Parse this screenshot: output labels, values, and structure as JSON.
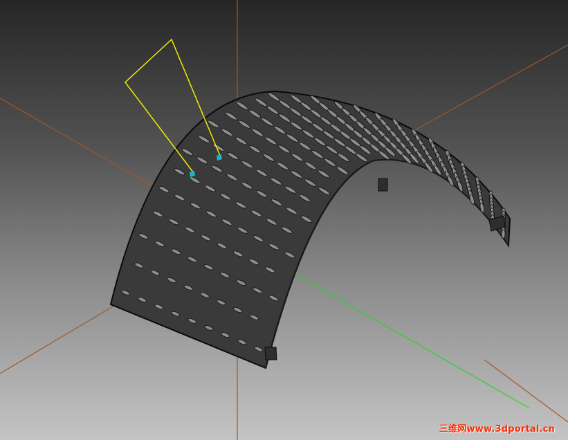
{
  "viewport": {
    "background_top": "#262626",
    "background_bottom": "#c4c4c4"
  },
  "colors": {
    "axis_orange": "#a0562a",
    "axis_green": "#27d327",
    "selection_yellow": "#f0f000",
    "highlight_cyan": "#19b8c8",
    "part_fill": "#3a3a3a",
    "part_outline": "#0b0b0b",
    "hole": "#8c8c8c",
    "watermark_red": "#ff2a00"
  },
  "watermark": {
    "text": "三维网www.3dportal.cn"
  },
  "part": {
    "name": "perforated-arch-screen",
    "hole_rows": 9
  }
}
